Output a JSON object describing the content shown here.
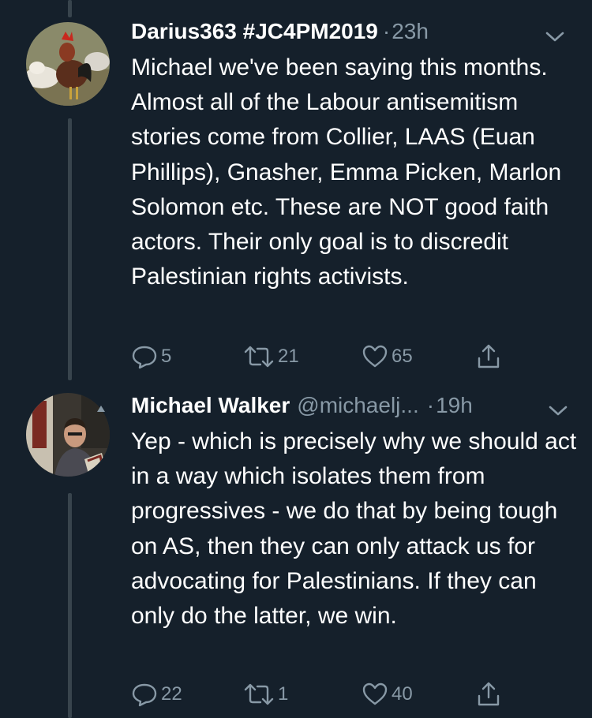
{
  "tweets": [
    {
      "author": "Darius363 #JC4PM2019",
      "handle": "",
      "separator": "·",
      "time": "23h",
      "text": "Michael we've been saying this months. Almost all of the Labour antisemitism stories come from Collier, LAAS (Euan Phillips), Gnasher, Emma Picken, Marlon Solomon etc. These are NOT good faith actors. Their only goal is to discredit Palestinian rights activists.",
      "replies": "5",
      "retweets": "21",
      "likes": "65"
    },
    {
      "author": "Michael Walker",
      "handle": "@michaelj...",
      "separator": "·",
      "time": "19h",
      "text": "Yep - which is precisely why we should act in a way which isolates them from progressives - we do that by being tough on AS, then they can only attack us for advocating for Palestinians. If they can only do the latter, we win.",
      "replies": "22",
      "retweets": "1",
      "likes": "40"
    }
  ],
  "colors": {
    "background": "#15202b",
    "text": "#ffffff",
    "secondary": "#8899a6",
    "thread_line": "#38444d"
  },
  "icons": [
    "reply-icon",
    "retweet-icon",
    "like-icon",
    "share-icon",
    "chevron-down-icon"
  ]
}
